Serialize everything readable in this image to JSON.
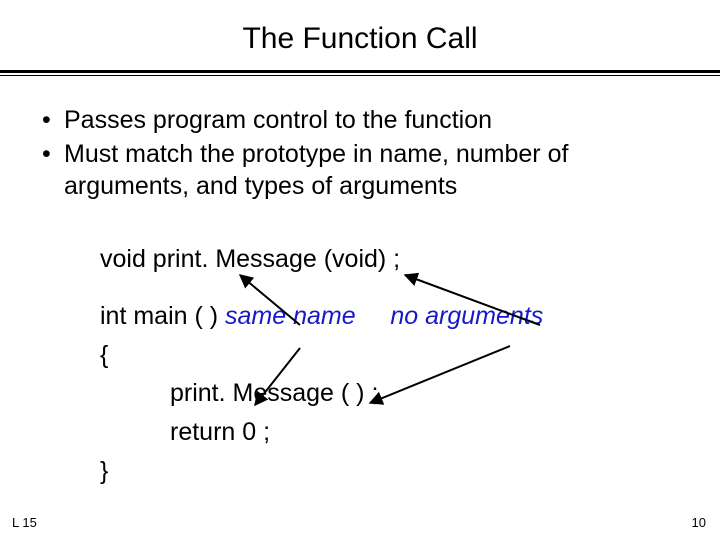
{
  "title": "The Function Call",
  "bullets": [
    "Passes program control to  the function",
    "Must match the prototype in name, number of arguments, and types of arguments"
  ],
  "code": {
    "prototype": "void print. Message (void) ;",
    "main_sig": "int main ( ) ",
    "same_name": "same name",
    "no_args": "no arguments",
    "brace_open": "{",
    "call": "print. Message ( ) ;",
    "ret": "return 0 ;",
    "brace_close": "}"
  },
  "annotations": {
    "same_name_color": "#1818c8",
    "no_args_color": "#1818c8"
  },
  "footer": {
    "left": "L 15",
    "right": "10"
  }
}
